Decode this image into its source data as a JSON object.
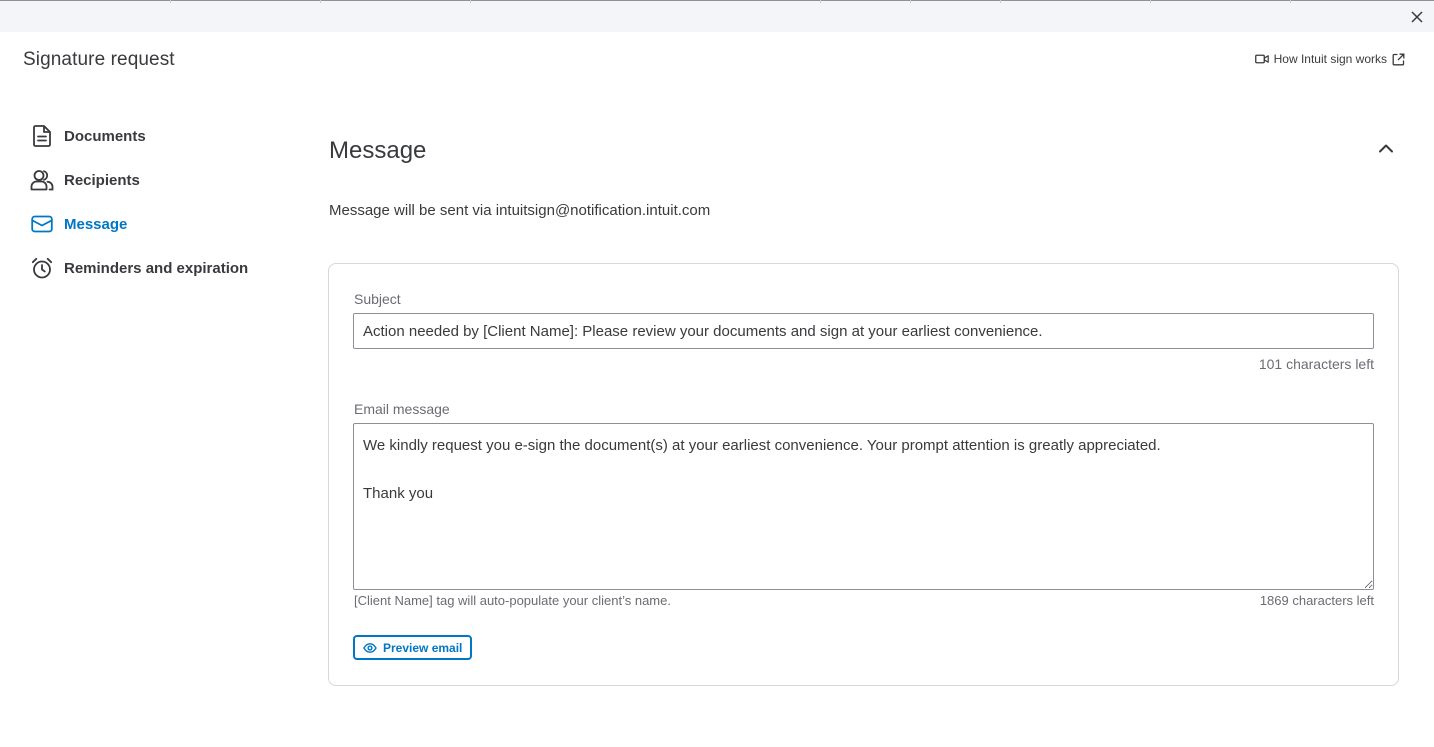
{
  "modal": {
    "title": "Signature request",
    "help_link": "How Intuit sign works",
    "close_icon": "close-icon"
  },
  "sidebar": {
    "items": [
      {
        "label": "Documents",
        "icon": "document-icon",
        "active": false
      },
      {
        "label": "Recipients",
        "icon": "users-icon",
        "active": false
      },
      {
        "label": "Message",
        "icon": "envelope-icon",
        "active": true
      },
      {
        "label": "Reminders and expiration",
        "icon": "alarm-clock-icon",
        "active": false
      }
    ]
  },
  "section": {
    "title": "Message",
    "sent_via": "Message will be sent via intuitsign@notification.intuit.com"
  },
  "form": {
    "subject_label": "Subject",
    "subject_value": "Action needed by [Client Name]: Please review your documents and sign at your earliest convenience.",
    "subject_counter": "101 characters left",
    "email_label": "Email message",
    "email_value": "We kindly request you e-sign the document(s) at your earliest convenience. Your prompt attention is greatly appreciated.\n\nThank you",
    "email_hint": "[Client Name] tag will auto-populate your client’s name.",
    "email_counter": "1869 characters left",
    "preview_label": "Preview email"
  },
  "colors": {
    "accent": "#0077c5",
    "text": "#393a3d",
    "muted": "#6b6c72",
    "border": "#d4d7dc"
  }
}
